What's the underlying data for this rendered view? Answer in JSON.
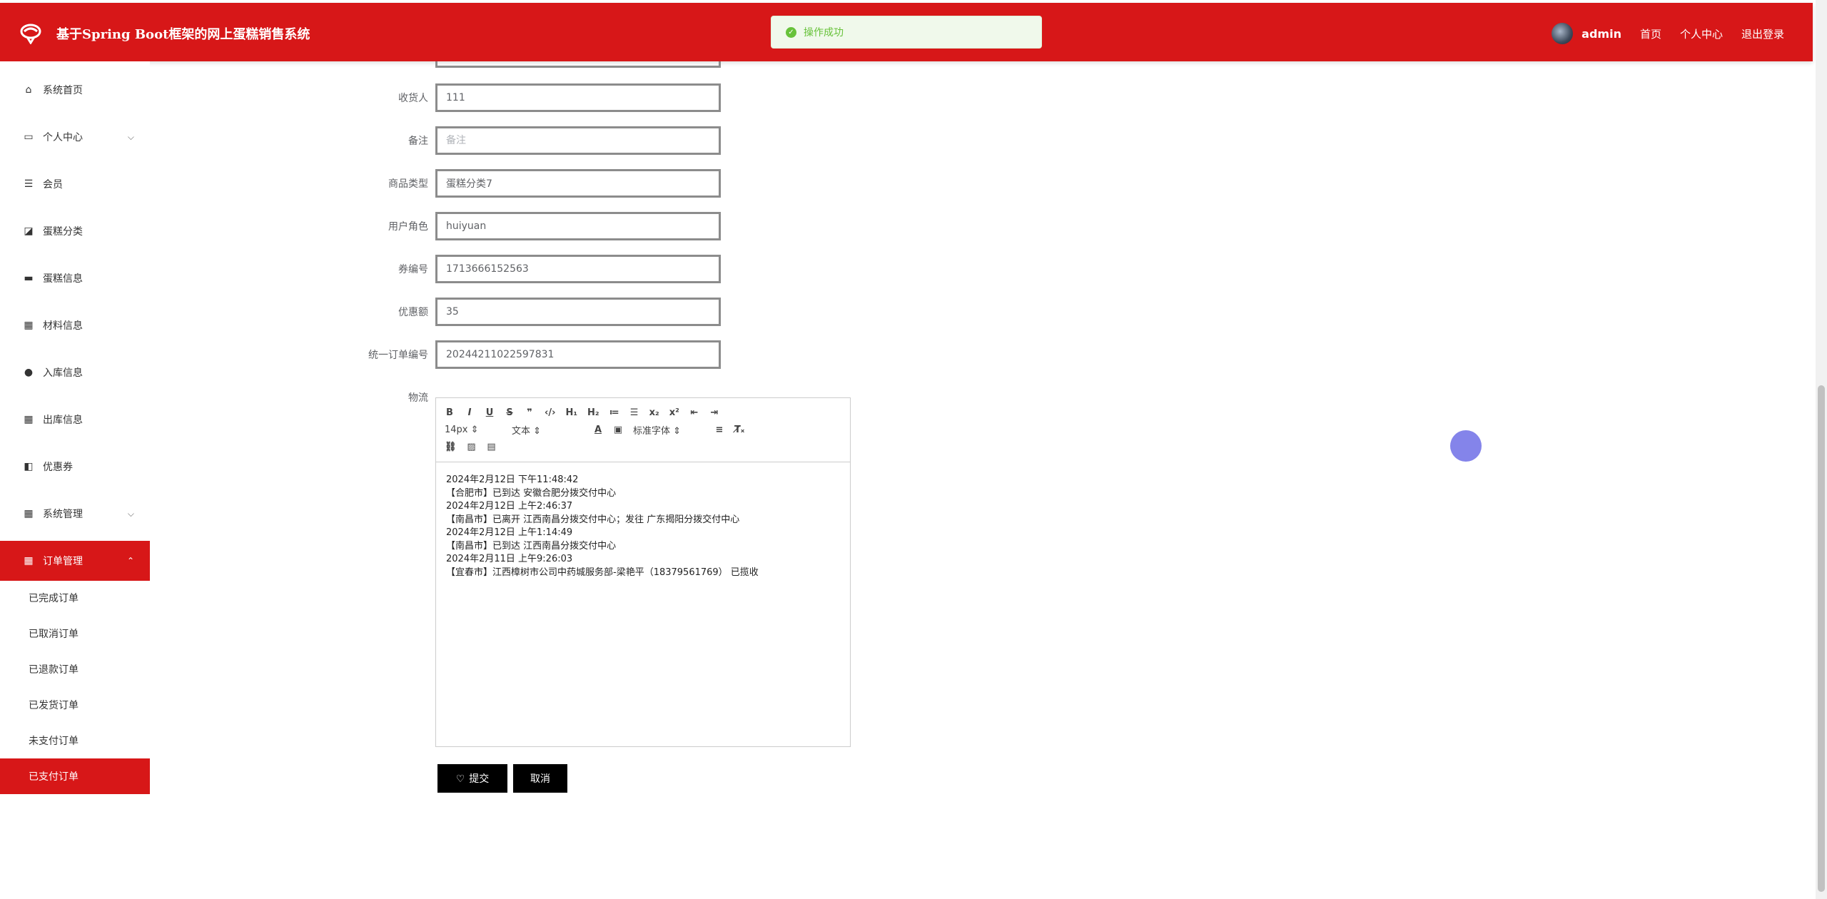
{
  "header": {
    "title": "基于Spring Boot框架的网上蛋糕销售系统",
    "user": "admin",
    "links": [
      "首页",
      "个人中心",
      "退出登录"
    ]
  },
  "toast": {
    "message": "操作成功"
  },
  "sidebar": {
    "items": [
      {
        "label": "系统首页",
        "icon": "home-icon"
      },
      {
        "label": "个人中心",
        "icon": "profile-icon"
      },
      {
        "label": "会员",
        "icon": "list-icon"
      },
      {
        "label": "蛋糕分类",
        "icon": "chart-icon"
      },
      {
        "label": "蛋糕信息",
        "icon": "monitor-icon"
      },
      {
        "label": "材料信息",
        "icon": "grid-icon"
      },
      {
        "label": "入库信息",
        "icon": "user-icon"
      },
      {
        "label": "出库信息",
        "icon": "grid-icon"
      },
      {
        "label": "优惠券",
        "icon": "coupon-icon"
      },
      {
        "label": "系统管理",
        "icon": "grid-icon"
      },
      {
        "label": "订单管理",
        "icon": "table-icon"
      }
    ],
    "subitems": [
      "已完成订单",
      "已取消订单",
      "已退款订单",
      "已发货订单",
      "未支付订单",
      "已支付订单"
    ]
  },
  "form": {
    "fields": [
      {
        "label": "收货人",
        "value": "111",
        "placeholder": "收货人"
      },
      {
        "label": "备注",
        "value": "",
        "placeholder": "备注"
      },
      {
        "label": "商品类型",
        "value": "蛋糕分类7",
        "placeholder": "商品类型"
      },
      {
        "label": "用户角色",
        "value": "huiyuan",
        "placeholder": "用户角色"
      },
      {
        "label": "券编号",
        "value": "1713666152563",
        "placeholder": "券编号"
      },
      {
        "label": "优惠额",
        "value": "35",
        "placeholder": "优惠额"
      },
      {
        "label": "统一订单编号",
        "value": "20244211022597831",
        "placeholder": "统一订单编号"
      }
    ],
    "logistics_label": "物流",
    "editor": {
      "font_size": "14px",
      "block_format": "文本",
      "font_family": "标准字体",
      "lines": [
        "2024年2月12日 下午11:48:42",
        "【合肥市】已到达 安徽合肥分拨交付中心",
        "2024年2月12日 上午2:46:37",
        "【南昌市】已离开 江西南昌分拨交付中心；发往 广东揭阳分拨交付中心",
        "2024年2月12日 上午1:14:49",
        "【南昌市】已到达 江西南昌分拨交付中心",
        "2024年2月11日 上午9:26:03",
        "【宜春市】江西樟树市公司中药城服务部-梁艳平（18379561769） 已揽收"
      ]
    },
    "submit_label": "提交",
    "cancel_label": "取消"
  },
  "colors": {
    "primary": "#d71718",
    "success": "#67c23a"
  }
}
